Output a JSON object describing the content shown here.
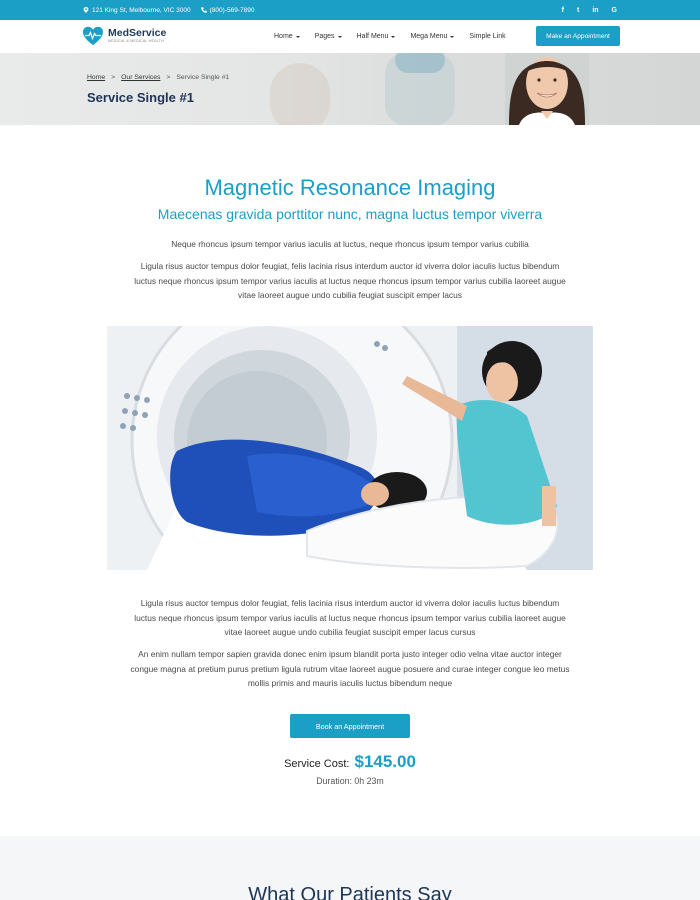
{
  "topbar": {
    "address": "121 King St, Melbourne, VIC 3000",
    "phone": "(800)-569-7890",
    "socials": [
      "f",
      "t",
      "in",
      "G"
    ]
  },
  "header": {
    "brand": "MedService",
    "tagline": "MEDICAL & MEDICAL HEALTH",
    "nav": [
      {
        "label": "Home"
      },
      {
        "label": "Pages"
      },
      {
        "label": "Half Menu"
      },
      {
        "label": "Mega Menu"
      },
      {
        "label": "Simple Link"
      }
    ],
    "cta": "Make an Appointment"
  },
  "banner": {
    "breadcrumb": [
      "Home",
      "Our Services",
      "Service Single #1"
    ],
    "title": "Service Single #1"
  },
  "content": {
    "title": "Magnetic Resonance Imaging",
    "subtitle": "Maecenas gravida porttitor nunc, magna luctus tempor viverra",
    "p1": "Neque rhoncus ipsum tempor varius iaculis at luctus, neque rhoncus ipsum tempor varius cubilia",
    "p2": "Ligula risus auctor tempus dolor feugiat, felis lacinia risus interdum auctor id viverra dolor iaculis luctus bibendum luctus neque rhoncus ipsum tempor varius iaculis at luctus neque rhoncus ipsum tempor varius cubilia laoreet augue vitae laoreet augue undo cubilia feugiat suscipit emper lacus",
    "p3": "Ligula risus auctor tempus dolor feugiat, felis lacinia risus interdum auctor id viverra dolor iaculis luctus bibendum luctus neque rhoncus ipsum tempor varius iaculis at luctus neque rhoncus ipsum tempor varius cubilia laoreet augue vitae laoreet augue undo cubilia feugiat suscipit emper lacus cursus",
    "p4": "An enim nullam tempor sapien gravida donec enim ipsum blandit porta justo integer odio velna vitae auctor integer congue magna at pretium purus pretium ligula rutrum vitae laoreet augue posuere and curae integer congue leo metus mollis primis and mauris iaculis luctus bibendum neque",
    "book_label": "Book an Appointment",
    "cost_label": "Service Cost:",
    "cost_value": "$145.00",
    "duration": "Duration: 0h 23m"
  },
  "patients": {
    "heading": "What Our Patients Say"
  },
  "colors": {
    "accent": "#1b9fc6",
    "navy": "#1d3557"
  }
}
